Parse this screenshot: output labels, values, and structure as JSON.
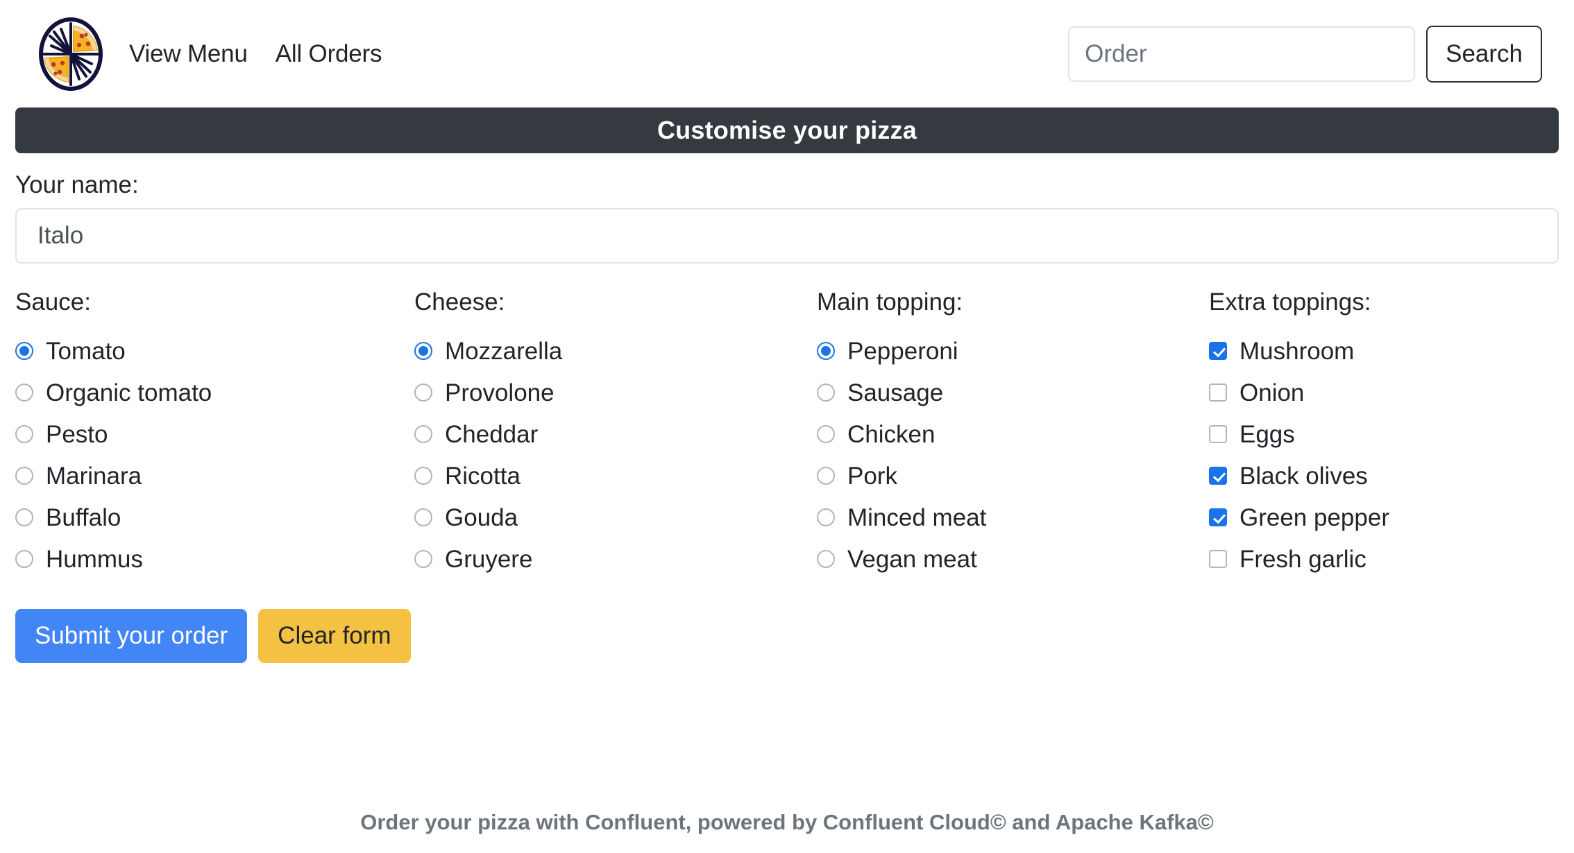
{
  "navbar": {
    "logo_icon": "pizza-logo-icon",
    "links": [
      {
        "label": "View Menu"
      },
      {
        "label": "All Orders"
      }
    ],
    "search": {
      "placeholder": "Order",
      "value": "",
      "button_label": "Search"
    }
  },
  "banner": {
    "title": "Customise your pizza"
  },
  "form": {
    "name_label": "Your name:",
    "name_value": "Italo",
    "name_placeholder": "Your name",
    "groups": [
      {
        "key": "sauce",
        "title": "Sauce:",
        "type": "radio",
        "options": [
          {
            "label": "Tomato",
            "selected": true
          },
          {
            "label": "Organic tomato",
            "selected": false
          },
          {
            "label": "Pesto",
            "selected": false
          },
          {
            "label": "Marinara",
            "selected": false
          },
          {
            "label": "Buffalo",
            "selected": false
          },
          {
            "label": "Hummus",
            "selected": false
          }
        ]
      },
      {
        "key": "cheese",
        "title": "Cheese:",
        "type": "radio",
        "options": [
          {
            "label": "Mozzarella",
            "selected": true
          },
          {
            "label": "Provolone",
            "selected": false
          },
          {
            "label": "Cheddar",
            "selected": false
          },
          {
            "label": "Ricotta",
            "selected": false
          },
          {
            "label": "Gouda",
            "selected": false
          },
          {
            "label": "Gruyere",
            "selected": false
          }
        ]
      },
      {
        "key": "main_topping",
        "title": "Main topping:",
        "type": "radio",
        "options": [
          {
            "label": "Pepperoni",
            "selected": true
          },
          {
            "label": "Sausage",
            "selected": false
          },
          {
            "label": "Chicken",
            "selected": false
          },
          {
            "label": "Pork",
            "selected": false
          },
          {
            "label": "Minced meat",
            "selected": false
          },
          {
            "label": "Vegan meat",
            "selected": false
          }
        ]
      },
      {
        "key": "extra_toppings",
        "title": "Extra toppings:",
        "type": "checkbox",
        "options": [
          {
            "label": "Mushroom",
            "selected": true
          },
          {
            "label": "Onion",
            "selected": false
          },
          {
            "label": "Eggs",
            "selected": false
          },
          {
            "label": "Black olives",
            "selected": true
          },
          {
            "label": "Green pepper",
            "selected": true
          },
          {
            "label": "Fresh garlic",
            "selected": false
          }
        ]
      }
    ],
    "submit_label": "Submit your order",
    "clear_label": "Clear form"
  },
  "footer": {
    "text": "Order your pizza with Confluent, powered by Confluent Cloud© and Apache Kafka©"
  },
  "colors": {
    "accent_blue": "#4285f4",
    "control_blue": "#1a73e8",
    "banner_dark": "#343a40",
    "clear_yellow": "#f4c142",
    "logo_navy": "#1b1b3a",
    "footer_gray": "#6c757d"
  }
}
